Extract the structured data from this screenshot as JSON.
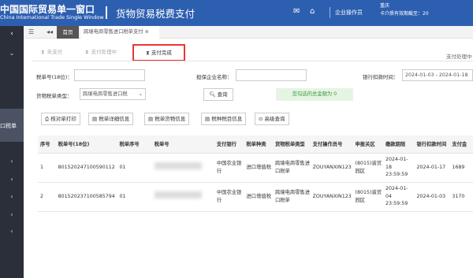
{
  "header": {
    "logo_cn": "中国国际贸易单一窗口",
    "logo_en": "China International Trade Single Window",
    "app_title": "货物贸易税费支付",
    "user_type": "企业操作员",
    "user_line1": "重庆",
    "user_line2": "卡介质有效期截至：20"
  },
  "sidebar": {
    "items": [
      "‹",
      "⌄",
      "‹",
      "‹",
      "‹",
      "‹",
      "‹"
    ],
    "active_label": "口税单"
  },
  "tabbar": {
    "home": "首页",
    "current": "跨境电商零售进口税单支付"
  },
  "subtabs": {
    "unpaid": "未支付",
    "processing": "支付处理中",
    "completed": "支付完成",
    "right_hint": "支付处理中"
  },
  "form": {
    "tax_no_label": "税单号(18位)：",
    "tax_no_value": "",
    "guarantor_label": "担保企业名称：",
    "guarantor_value": "",
    "date_label": "银行扣款时间：",
    "date_value": "2024-01-03 - 2024-01-18",
    "type_label": "货物税单类型：",
    "type_value": "跨境电商零售进口税",
    "search_label": "查询",
    "sum_text": "您勾选的总金额为 0"
  },
  "actions": [
    "核对单打印",
    "税单详细信息",
    "税单货物信息",
    "税种税目信息",
    "高级查询"
  ],
  "table": {
    "columns": [
      "序号",
      "税单号(18位)",
      "税单序号",
      "税单号",
      "支付银行",
      "税单种类",
      "货物税单类型",
      "支付操作员号",
      "申报关区",
      "缴款期限",
      "银行扣款时间",
      "支付金"
    ],
    "rows": [
      [
        "1",
        "801520247100590112",
        "01",
        "",
        "中国农业银行",
        "进口增值税",
        "跨境电商零售进口税单",
        "ZOUYANXIN123",
        "(8015)渝贸园区",
        "2024-01-18 23:59:59",
        "2024-01-17",
        "1689"
      ],
      [
        "2",
        "801520237100585794",
        "01",
        "",
        "中国农业银行",
        "进口增值税",
        "跨境电商零售进口税单",
        "ZOUYANXIN123",
        "(8015)渝贸园区",
        "2024-01-04 23:59:59",
        "2024-01-03",
        "3170"
      ]
    ]
  }
}
